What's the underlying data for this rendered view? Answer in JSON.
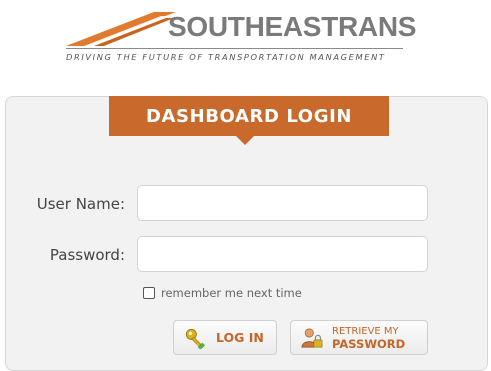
{
  "brand": {
    "name_prefix": "SOUTHEAS",
    "name_suffix": "TRANS",
    "tagline": "DRIVING THE FUTURE OF TRANSPORTATION MANAGEMENT"
  },
  "login": {
    "title": "DASHBOARD LOGIN",
    "username_label": "User Name:",
    "username_value": "",
    "password_label": "Password:",
    "password_value": "",
    "remember_label": "remember me next time",
    "remember_checked": false,
    "login_button_label": "LOG IN",
    "retrieve_button_line1": "RETRIEVE MY",
    "retrieve_button_line2": "PASSWORD"
  },
  "colors": {
    "accent": "#c96a2c",
    "panel_background": "#f2f2f2",
    "logo_gray": "#7a7a7a"
  },
  "icons": {
    "logo_mark": "road-swoosh-icon",
    "login": "key-icon",
    "retrieve": "user-lock-icon"
  }
}
